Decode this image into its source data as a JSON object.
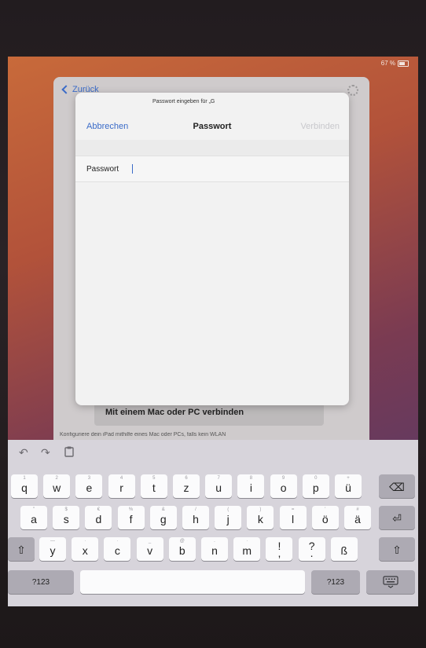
{
  "status_bar": {
    "battery_text": "67 %"
  },
  "background_panel": {
    "back_label": "Zurück",
    "mac_title": "Mit einem Mac oder PC verbinden",
    "mac_description": "Konfiguriere dein iPad mithilfe eines Mac oder PCs, falls kein WLAN"
  },
  "modal": {
    "prompt": "Passwort eingeben für „G",
    "cancel_label": "Abbrechen",
    "title": "Passwort",
    "connect_label": "Verbinden",
    "password_label": "Passwort",
    "password_value": ""
  },
  "keyboard": {
    "toolbar": {
      "undo_icon": "↶",
      "redo_icon": "↷",
      "clipboard_icon": "clipboard-icon"
    },
    "row1": [
      {
        "key": "q",
        "hint": "1"
      },
      {
        "key": "w",
        "hint": "2"
      },
      {
        "key": "e",
        "hint": "3"
      },
      {
        "key": "r",
        "hint": "4"
      },
      {
        "key": "t",
        "hint": "5"
      },
      {
        "key": "z",
        "hint": "6"
      },
      {
        "key": "u",
        "hint": "7"
      },
      {
        "key": "i",
        "hint": "8"
      },
      {
        "key": "o",
        "hint": "9"
      },
      {
        "key": "p",
        "hint": "0"
      },
      {
        "key": "ü",
        "hint": "+"
      }
    ],
    "row2": [
      {
        "key": "a",
        "hint": "\""
      },
      {
        "key": "s",
        "hint": "$"
      },
      {
        "key": "d",
        "hint": "€"
      },
      {
        "key": "f",
        "hint": "%"
      },
      {
        "key": "g",
        "hint": "&"
      },
      {
        "key": "h",
        "hint": "/"
      },
      {
        "key": "j",
        "hint": "("
      },
      {
        "key": "k",
        "hint": ")"
      },
      {
        "key": "l",
        "hint": "="
      },
      {
        "key": "ö",
        "hint": "'"
      },
      {
        "key": "ä",
        "hint": "#"
      }
    ],
    "row3": [
      {
        "key": "y",
        "hint": "—"
      },
      {
        "key": "x",
        "hint": "·"
      },
      {
        "key": "c",
        "hint": "·"
      },
      {
        "key": "v",
        "hint": "_"
      },
      {
        "key": "b",
        "hint": "@"
      },
      {
        "key": "n",
        "hint": "."
      },
      {
        "key": "m",
        "hint": "·"
      },
      {
        "key": "!\n,",
        "hint": ""
      },
      {
        "key": "?\n.",
        "hint": ""
      },
      {
        "key": "ß",
        "hint": ""
      }
    ],
    "numbers_label": "?123",
    "backspace_icon": "⌫",
    "return_icon": "⏎",
    "shift_icon": "⇧",
    "hide_keyboard_icon": "keyboard-hide-icon",
    "accent_color": "#3a6bc8"
  }
}
